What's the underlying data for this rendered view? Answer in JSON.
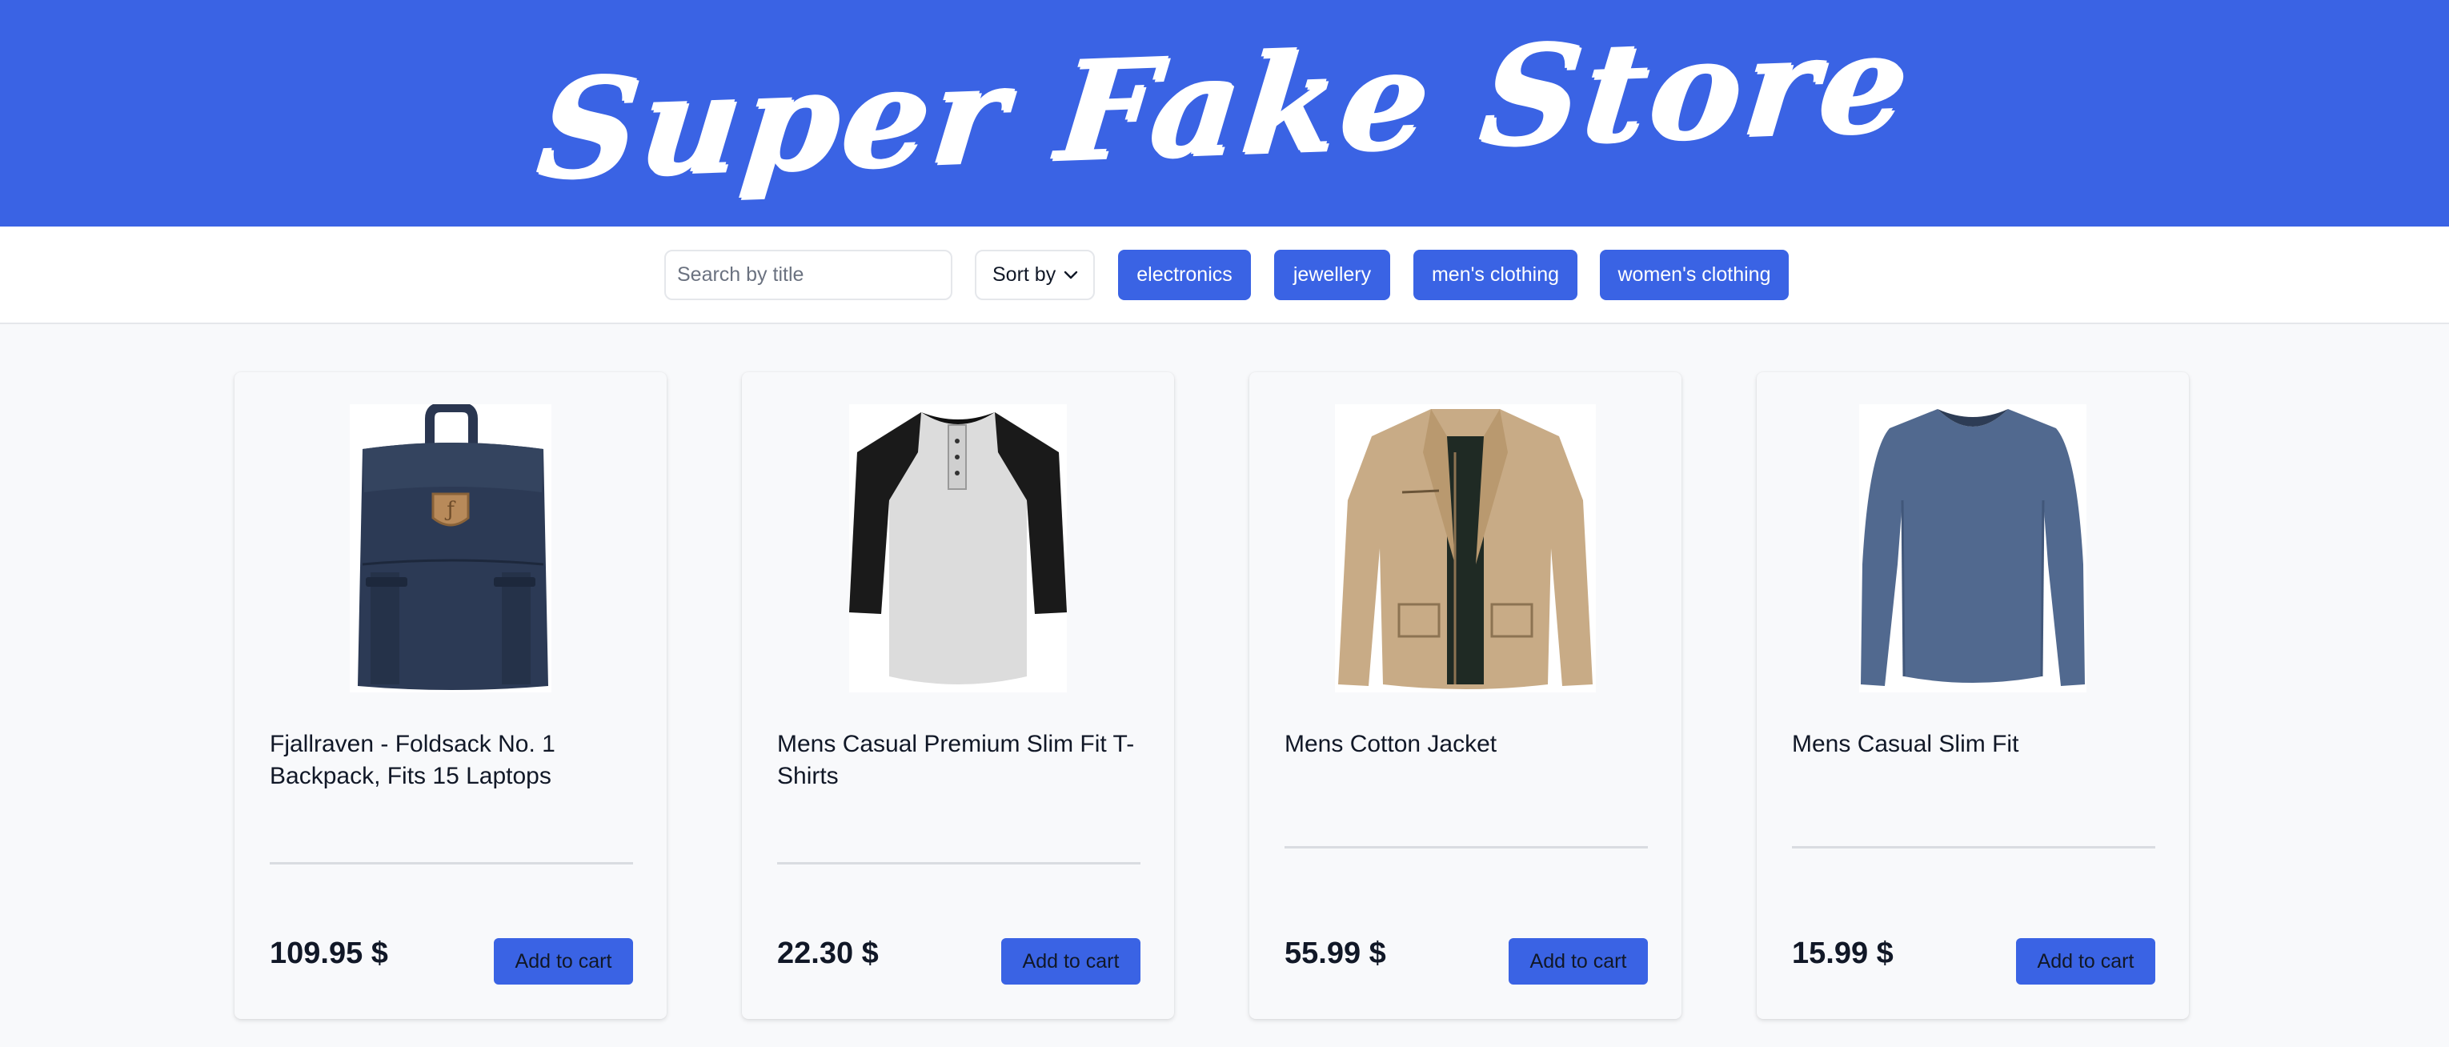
{
  "header": {
    "logo_text": "Super Fake Store"
  },
  "toolbar": {
    "search_placeholder": "Search by title",
    "sort_label": "Sort by",
    "categories": [
      "electronics",
      "jewellery",
      "men's clothing",
      "women's clothing"
    ]
  },
  "products": [
    {
      "title": "Fjallraven - Foldsack No. 1 Backpack, Fits 15 Laptops",
      "price": "109.95 $",
      "button": "Add to cart",
      "image": "backpack-image"
    },
    {
      "title": "Mens Casual Premium Slim Fit T-Shirts",
      "price": "22.30 $",
      "button": "Add to cart",
      "image": "raglan-tshirt-image"
    },
    {
      "title": "Mens Cotton Jacket",
      "price": "55.99 $",
      "button": "Add to cart",
      "image": "jacket-image"
    },
    {
      "title": "Mens Casual Slim Fit",
      "price": "15.99 $",
      "button": "Add to cart",
      "image": "long-sleeve-shirt-image"
    }
  ],
  "colors": {
    "brand": "#3a63e4",
    "background": "#f8f9fb"
  }
}
